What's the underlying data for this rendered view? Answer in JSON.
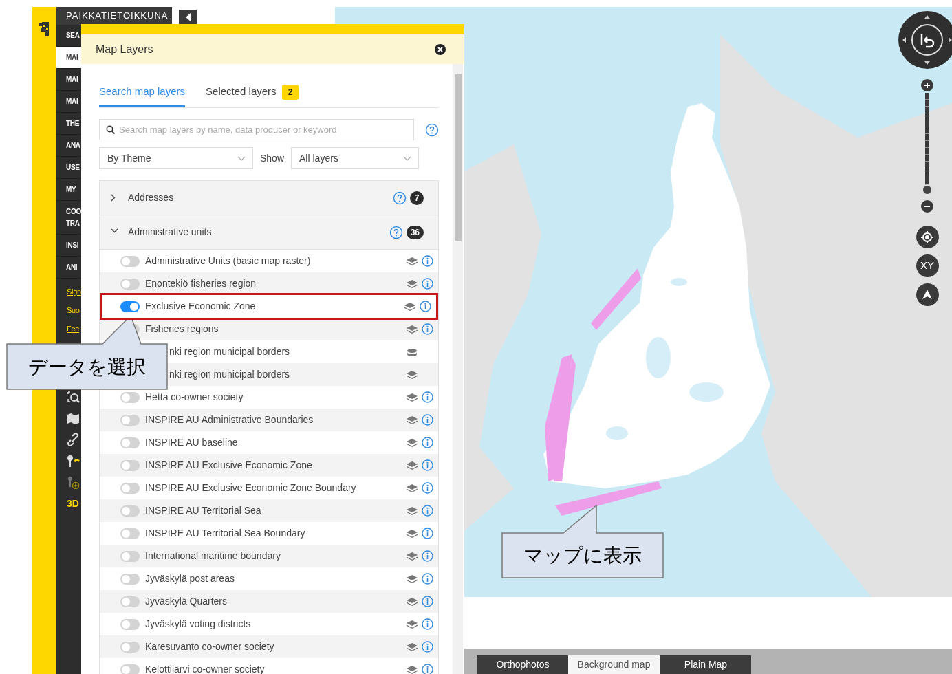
{
  "app": {
    "title": "PAIKKATIETOIKKUNA"
  },
  "sidebar": {
    "items": [
      {
        "label": "SEA",
        "selected": false
      },
      {
        "label": "MAI",
        "selected": true
      },
      {
        "label": "MAI",
        "selected": false
      },
      {
        "label": "MAI",
        "selected": false
      },
      {
        "label": "THE",
        "selected": false
      },
      {
        "label": "ANA",
        "selected": false
      },
      {
        "label": "USE",
        "selected": false
      },
      {
        "label": "MY",
        "selected": false
      },
      {
        "label": "COO TRA",
        "selected": false
      },
      {
        "label": "INSI",
        "selected": false
      },
      {
        "label": "ANI",
        "selected": false
      }
    ],
    "links": [
      "Sign",
      "Suo",
      "Fee"
    ],
    "tools": [
      {
        "kind": "zoom-box"
      },
      {
        "kind": "map"
      },
      {
        "kind": "link"
      },
      {
        "kind": "marker"
      },
      {
        "kind": "marker-add"
      },
      {
        "kind": "text",
        "label": "3D"
      }
    ]
  },
  "panel": {
    "title": "Map Layers",
    "tabs": [
      {
        "label": "Search map layers",
        "selected": true
      },
      {
        "label": "Selected layers",
        "selected": false,
        "badge": "2"
      }
    ],
    "search": {
      "placeholder": "Search map layers by name, data producer or keyword"
    },
    "grouping": {
      "value": "By Theme"
    },
    "show_label": "Show",
    "filter": {
      "value": "All layers"
    },
    "groups": [
      {
        "label": "Addresses",
        "expanded": false,
        "count": "7"
      },
      {
        "label": "Administrative units",
        "expanded": true,
        "count": "36"
      }
    ],
    "layers": [
      {
        "name": "Administrative Units (basic map raster)",
        "on": false,
        "kind": "layers",
        "info": true
      },
      {
        "name": "Enontekiö fisheries region",
        "on": false,
        "kind": "layers",
        "info": true
      },
      {
        "name": "Exclusive Economic Zone",
        "on": true,
        "kind": "layers",
        "info": true,
        "highlighted": true
      },
      {
        "name": "Fisheries regions",
        "on": false,
        "kind": "layers",
        "info": true
      },
      {
        "name": "nki region municipal borders",
        "kind": "database",
        "info": false
      },
      {
        "name": "nki region municipal borders",
        "kind": "layers",
        "info": false
      },
      {
        "name": "Hetta co-owner society",
        "on": false,
        "kind": "layers",
        "info": true
      },
      {
        "name": "INSPIRE AU Administrative Boundaries",
        "on": false,
        "kind": "layers",
        "info": true
      },
      {
        "name": "INSPIRE AU baseline",
        "on": false,
        "kind": "layers",
        "info": true
      },
      {
        "name": "INSPIRE AU Exclusive Economic Zone",
        "on": false,
        "kind": "layers",
        "info": true
      },
      {
        "name": "INSPIRE AU Exclusive Economic Zone Boundary",
        "on": false,
        "kind": "layers",
        "info": true
      },
      {
        "name": "INSPIRE AU Territorial Sea",
        "on": false,
        "kind": "layers",
        "info": true
      },
      {
        "name": "INSPIRE AU Territorial Sea Boundary",
        "on": false,
        "kind": "layers",
        "info": true
      },
      {
        "name": "International maritime boundary",
        "on": false,
        "kind": "layers",
        "info": true
      },
      {
        "name": "Jyväskylä post areas",
        "on": false,
        "kind": "layers",
        "info": true
      },
      {
        "name": "Jyväskylä Quarters",
        "on": false,
        "kind": "layers",
        "info": true
      },
      {
        "name": "Jyväskylä voting districts",
        "on": false,
        "kind": "layers",
        "info": true
      },
      {
        "name": "Karesuvanto co-owner society",
        "on": false,
        "kind": "layers",
        "info": true
      },
      {
        "name": "Kelottijärvi co-owner society",
        "on": false,
        "kind": "layers",
        "info": true
      }
    ]
  },
  "map": {
    "kind": "picture",
    "zoom": {
      "level": 0.1
    },
    "controls": [
      {
        "kind": "locate"
      },
      {
        "kind": "text",
        "label": "XY"
      },
      {
        "kind": "north"
      }
    ],
    "basemaps": [
      {
        "label": "Orthophotos",
        "selected": false
      },
      {
        "label": "Background map",
        "selected": true
      },
      {
        "label": "Plain Map",
        "selected": false
      }
    ]
  },
  "callouts": [
    {
      "text": "データを選択"
    },
    {
      "text": "マップに表示"
    }
  ]
}
